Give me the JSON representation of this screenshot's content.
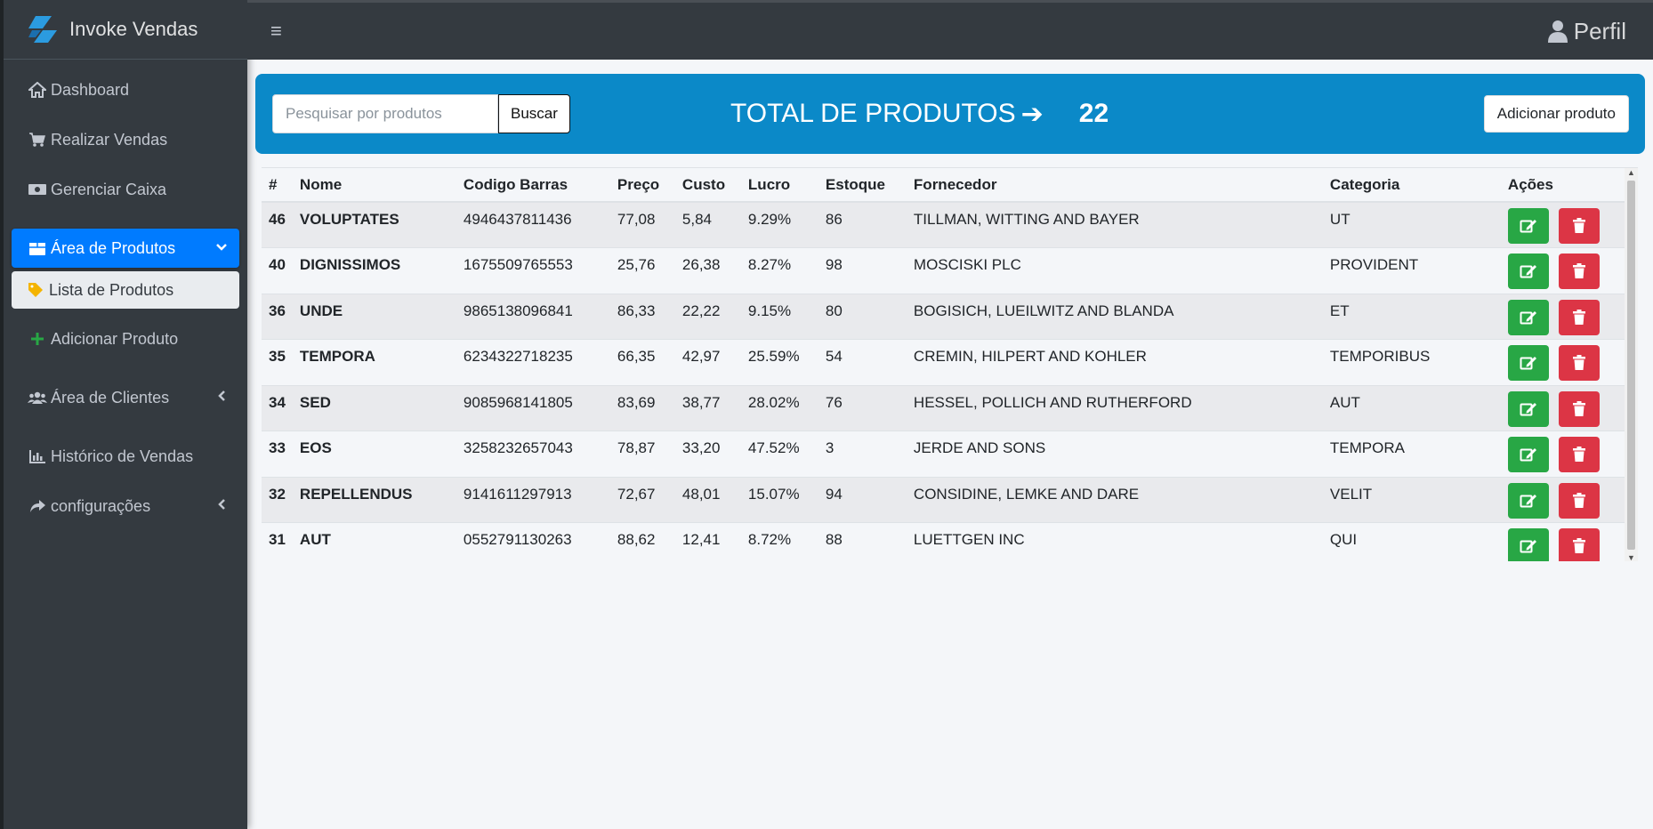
{
  "brand": {
    "name": "Invoke Vendas"
  },
  "sidebar": {
    "items": [
      {
        "label": "Dashboard",
        "icon": "home-icon"
      },
      {
        "label": "Realizar Vendas",
        "icon": "cart-icon"
      },
      {
        "label": "Gerenciar Caixa",
        "icon": "money-icon"
      },
      {
        "label": "Área de Produtos",
        "icon": "box-icon",
        "active": true
      },
      {
        "label": "Lista de Produtos",
        "icon": "tag-icon",
        "sub_active": true
      },
      {
        "label": "Adicionar Produto",
        "icon": "plus-icon"
      },
      {
        "label": "Área de Clientes",
        "icon": "users-icon"
      },
      {
        "label": "Histórico de Vendas",
        "icon": "chart-icon"
      },
      {
        "label": "configurações",
        "icon": "share-icon"
      }
    ]
  },
  "topbar": {
    "menu_icon": "≡",
    "profile_label": "Perfil"
  },
  "panel": {
    "search_placeholder": "Pesquisar por produtos",
    "search_button": "Buscar",
    "total_label": "TOTAL DE PRODUTOS",
    "total_arrow": "➔",
    "total_count": "22",
    "add_button": "Adicionar produto"
  },
  "table": {
    "headers": [
      "#",
      "Nome",
      "Codigo Barras",
      "Preço",
      "Custo",
      "Lucro",
      "Estoque",
      "Fornecedor",
      "Categoria",
      "Ações"
    ],
    "rows": [
      {
        "id": "46",
        "nome": "VOLUPTATES",
        "codigo": "4946437811436",
        "preco": "77,08",
        "custo": "5,84",
        "lucro": "9.29%",
        "estoque": "86",
        "fornecedor": "TILLMAN, WITTING AND BAYER",
        "categoria": "UT"
      },
      {
        "id": "40",
        "nome": "DIGNISSIMOS",
        "codigo": "1675509765553",
        "preco": "25,76",
        "custo": "26,38",
        "lucro": "8.27%",
        "estoque": "98",
        "fornecedor": "MOSCISKI PLC",
        "categoria": "PROVIDENT"
      },
      {
        "id": "36",
        "nome": "UNDE",
        "codigo": "9865138096841",
        "preco": "86,33",
        "custo": "22,22",
        "lucro": "9.15%",
        "estoque": "80",
        "fornecedor": "BOGISICH, LUEILWITZ AND BLANDA",
        "categoria": "ET"
      },
      {
        "id": "35",
        "nome": "TEMPORA",
        "codigo": "6234322718235",
        "preco": "66,35",
        "custo": "42,97",
        "lucro": "25.59%",
        "estoque": "54",
        "fornecedor": "CREMIN, HILPERT AND KOHLER",
        "categoria": "TEMPORIBUS"
      },
      {
        "id": "34",
        "nome": "SED",
        "codigo": "9085968141805",
        "preco": "83,69",
        "custo": "38,77",
        "lucro": "28.02%",
        "estoque": "76",
        "fornecedor": "HESSEL, POLLICH AND RUTHERFORD",
        "categoria": "AUT"
      },
      {
        "id": "33",
        "nome": "EOS",
        "codigo": "3258232657043",
        "preco": "78,87",
        "custo": "33,20",
        "lucro": "47.52%",
        "estoque": "3",
        "fornecedor": "JERDE AND SONS",
        "categoria": "TEMPORA"
      },
      {
        "id": "32",
        "nome": "REPELLENDUS",
        "codigo": "9141611297913",
        "preco": "72,67",
        "custo": "48,01",
        "lucro": "15.07%",
        "estoque": "94",
        "fornecedor": "CONSIDINE, LEMKE AND DARE",
        "categoria": "VELIT"
      },
      {
        "id": "31",
        "nome": "AUT",
        "codigo": "0552791130263",
        "preco": "88,62",
        "custo": "12,41",
        "lucro": "8.72%",
        "estoque": "88",
        "fornecedor": "LUETTGEN INC",
        "categoria": "QUI"
      }
    ]
  },
  "colors": {
    "sidebar": "#343a40",
    "active": "#007bff",
    "panel": "#0b89c8",
    "edit": "#28a745",
    "delete": "#dc3545"
  }
}
